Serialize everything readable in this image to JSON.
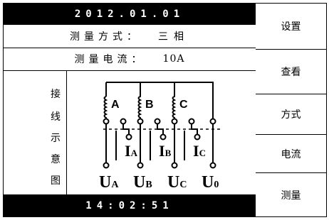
{
  "header": {
    "date": "2012.01.01"
  },
  "rows": [
    {
      "label": "测量方式：",
      "value": "三相"
    },
    {
      "label": "测量电流：",
      "value": "10A"
    }
  ],
  "diagram": {
    "side_label": [
      "接",
      "线",
      "示",
      "意",
      "图"
    ],
    "phases": [
      "A",
      "B",
      "C"
    ],
    "current_labels": [
      {
        "main": "I",
        "sub": "A"
      },
      {
        "main": "I",
        "sub": "B"
      },
      {
        "main": "I",
        "sub": "C"
      }
    ],
    "voltage_labels": [
      {
        "main": "U",
        "sub": "A"
      },
      {
        "main": "U",
        "sub": "B"
      },
      {
        "main": "U",
        "sub": "C"
      },
      {
        "main": "U",
        "sub": "0"
      }
    ]
  },
  "footer": {
    "time": "14:02:51"
  },
  "menu": [
    {
      "label": "设置"
    },
    {
      "label": "查看"
    },
    {
      "label": "方式"
    },
    {
      "label": "电流"
    },
    {
      "label": "测量"
    }
  ]
}
